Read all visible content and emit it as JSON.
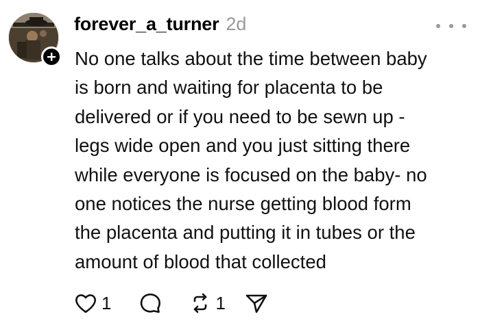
{
  "post": {
    "username": "forever_a_turner",
    "timestamp": "2d",
    "text": "No one talks about the time between baby\nis born and waiting for placenta to be\ndelivered or if you need to be sewn up -\nlegs wide open and you just sitting there\nwhile everyone is focused on the baby- no\none notices the nurse getting blood form\nthe placenta and putting it in tubes or the\namount of blood that collected",
    "likes": "1",
    "reposts": "1"
  },
  "icons": {
    "avatar": "profile-photo",
    "follow": "plus-icon",
    "more": "more-horizontal-icon",
    "like": "heart-icon",
    "comment": "comment-bubble-icon",
    "repost": "repost-icon",
    "share": "send-icon"
  },
  "colors": {
    "text": "#101010",
    "muted": "#999999",
    "badge": "#000000"
  }
}
